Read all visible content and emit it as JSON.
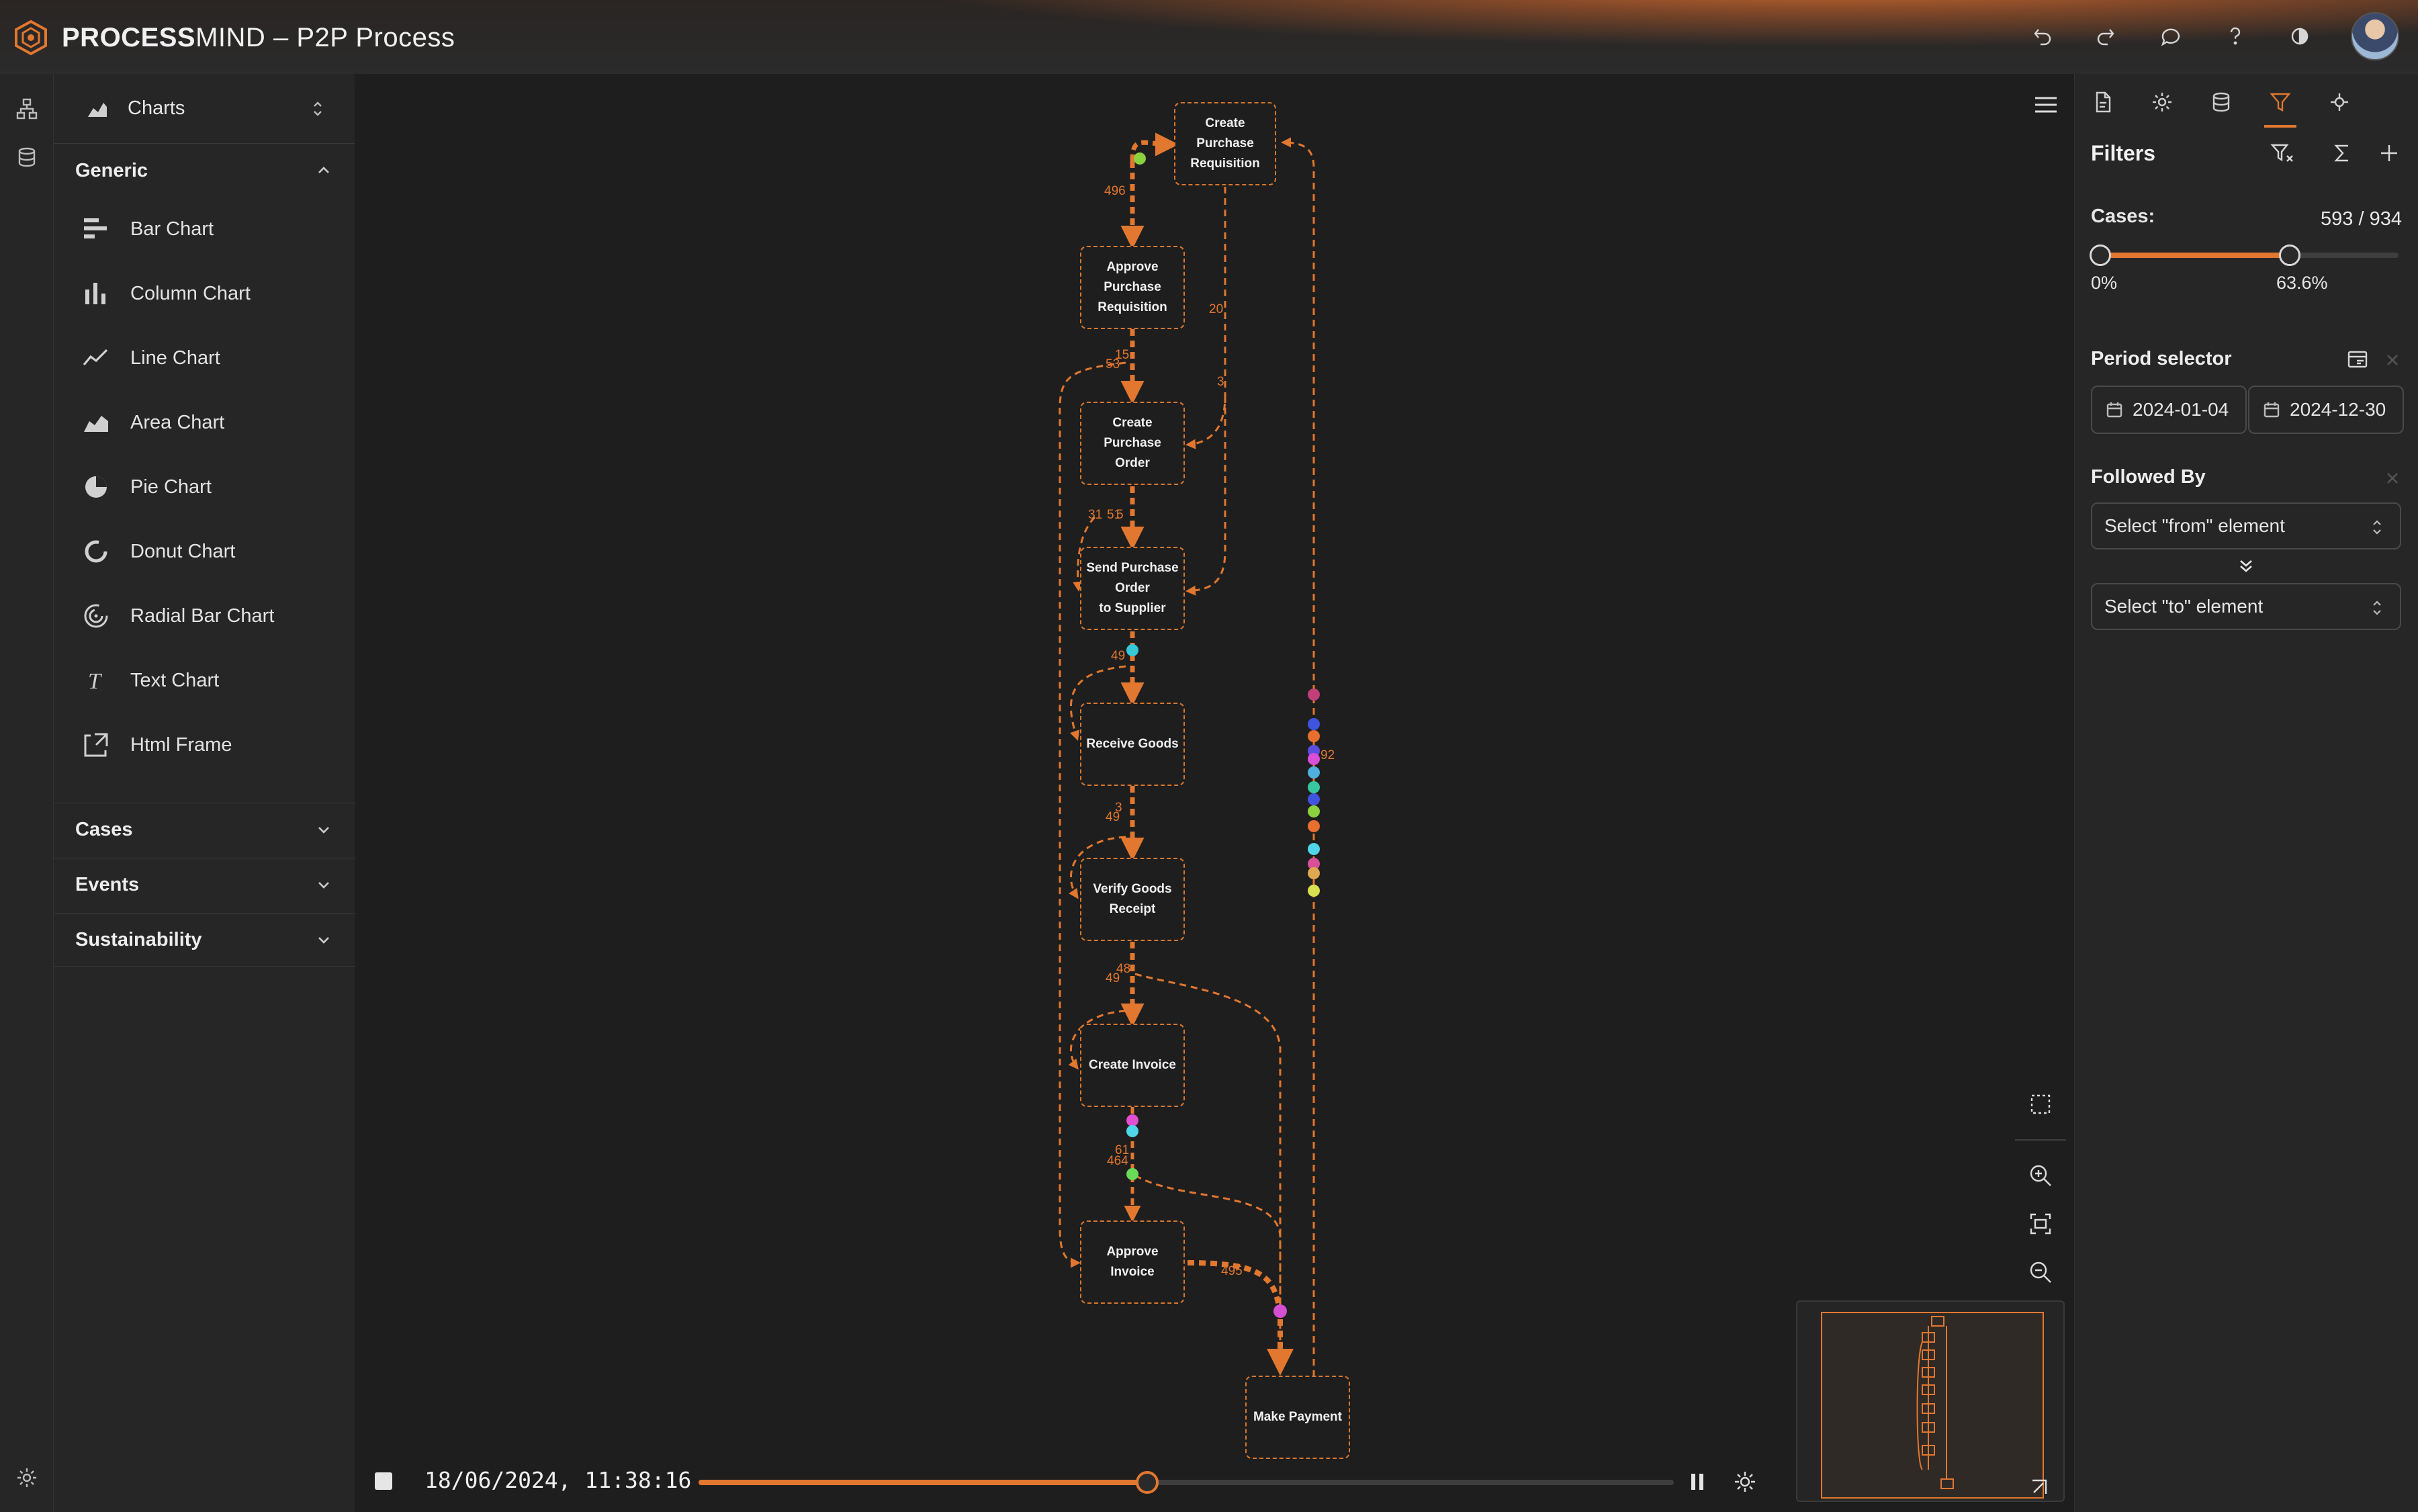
{
  "app": {
    "brand_bold": "PROCESS",
    "brand_light": "MIND",
    "separator": "–",
    "title": "P2P Process",
    "accent": "#e2772f"
  },
  "topbar": {
    "icons": [
      "undo-icon",
      "redo-icon",
      "comment-icon",
      "help-icon",
      "theme-toggle-icon",
      "user-avatar"
    ]
  },
  "left_rail": {
    "icons": [
      "process-map-icon",
      "database-icon",
      "settings-icon"
    ]
  },
  "panel": {
    "selector_label": "Charts",
    "sections": {
      "generic": "Generic",
      "cases": "Cases",
      "events": "Events",
      "sustainability": "Sustainability"
    },
    "items": [
      {
        "label": "Bar Chart",
        "icon": "bar-chart-icon"
      },
      {
        "label": "Column Chart",
        "icon": "column-chart-icon"
      },
      {
        "label": "Line Chart",
        "icon": "line-chart-icon"
      },
      {
        "label": "Area Chart",
        "icon": "area-chart-icon"
      },
      {
        "label": "Pie Chart",
        "icon": "pie-chart-icon"
      },
      {
        "label": "Donut Chart",
        "icon": "donut-chart-icon"
      },
      {
        "label": "Radial Bar Chart",
        "icon": "radial-bar-chart-icon"
      },
      {
        "label": "Text Chart",
        "icon": "text-chart-icon"
      },
      {
        "label": "Html Frame",
        "icon": "html-frame-icon"
      }
    ]
  },
  "process_map": {
    "nodes": [
      {
        "id": "n1",
        "label": "Create\nPurchase\nRequisition"
      },
      {
        "id": "n2",
        "label": "Approve\nPurchase\nRequisition"
      },
      {
        "id": "n3",
        "label": "Create\nPurchase\nOrder"
      },
      {
        "id": "n4",
        "label": "Send Purchase\nOrder\nto Supplier"
      },
      {
        "id": "n5",
        "label": "Receive Goods"
      },
      {
        "id": "n6",
        "label": "Verify Goods\nReceipt"
      },
      {
        "id": "n7",
        "label": "Create Invoice"
      },
      {
        "id": "n8",
        "label": "Approve\nInvoice"
      },
      {
        "id": "n9",
        "label": "Make Payment"
      }
    ],
    "edge_labels": [
      "496",
      "20",
      "3",
      "15",
      "53",
      "31",
      "51",
      "5",
      "49",
      "3",
      "49",
      "48",
      "49",
      "61",
      "464",
      "495",
      "92"
    ]
  },
  "player": {
    "timestamp": "18/06/2024, 11:38:16",
    "progress": 0.46
  },
  "filters": {
    "title": "Filters",
    "cases_label": "Cases:",
    "cases_value": "593 / 934",
    "range_min_label": "0%",
    "range_max_label": "63.6%",
    "range_min": 0,
    "range_max": 0.636,
    "period_label": "Period selector",
    "date_from": "2024-01-04",
    "date_to": "2024-12-30",
    "followed_by_label": "Followed By",
    "from_placeholder": "Select \"from\" element",
    "to_placeholder": "Select \"to\" element"
  }
}
